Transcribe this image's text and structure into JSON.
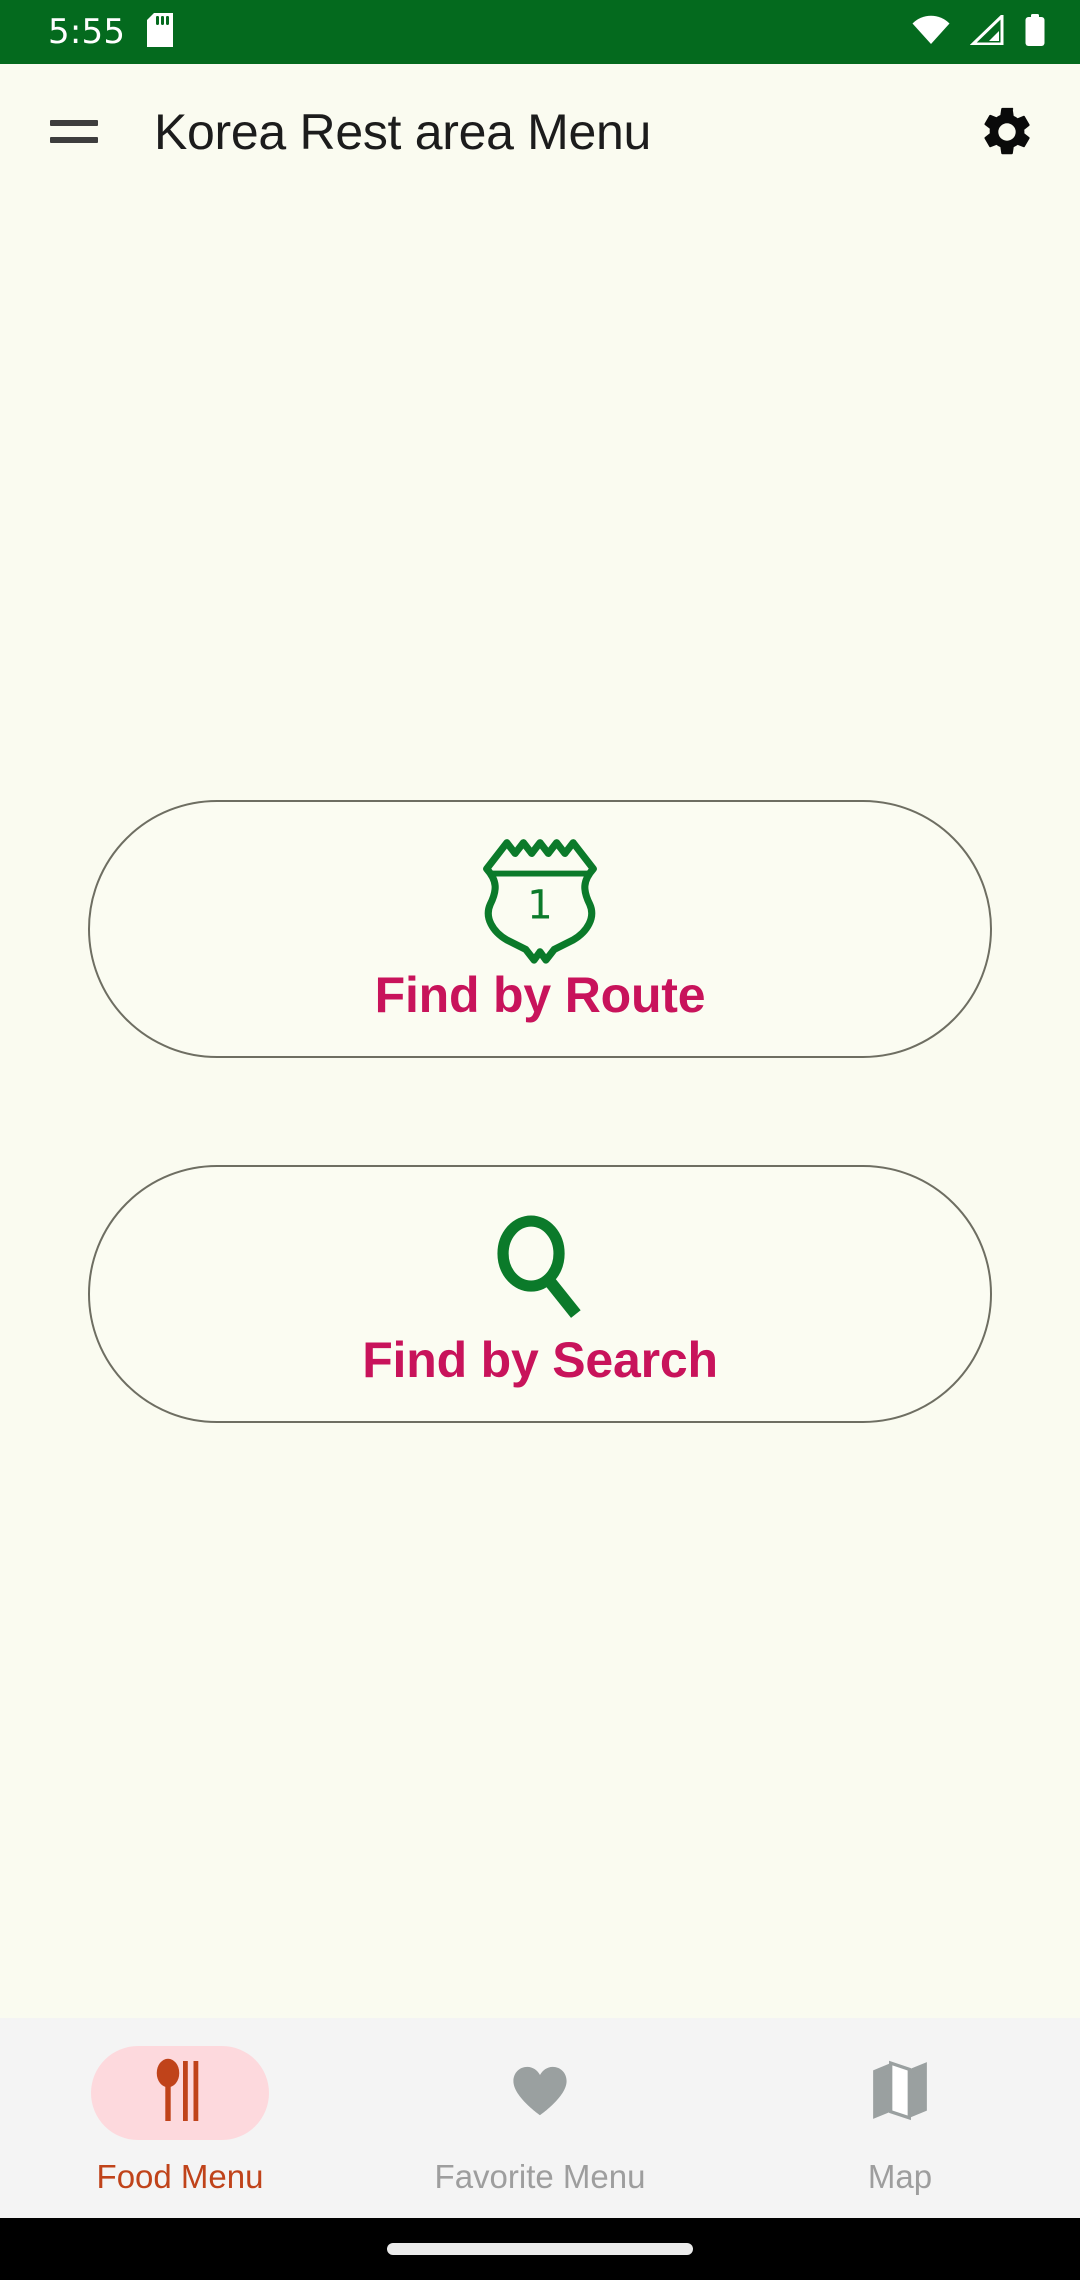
{
  "status_bar": {
    "time": "5:55",
    "background_color": "#046A1E",
    "icons": {
      "sd_card": "sd-card-icon",
      "wifi": "wifi-icon",
      "cellular": "cellular-signal-icon",
      "battery": "battery-full-icon"
    }
  },
  "app_bar": {
    "menu_icon": "hamburger-menu-icon",
    "title": "Korea Rest area Menu",
    "settings_icon": "gear-icon",
    "background_color": "#FAFBF0",
    "title_color": "#1C1C1C"
  },
  "main": {
    "buttons": [
      {
        "label": "Find by Route",
        "icon": "route-shield-icon",
        "icon_text": "1",
        "icon_color": "#0B7A2A",
        "label_color": "#C8135B",
        "border_color": "#6E6E62"
      },
      {
        "label": "Find by Search",
        "icon": "magnifying-glass-icon",
        "icon_color": "#0B7A2A",
        "label_color": "#C8135B",
        "border_color": "#6E6E62"
      }
    ]
  },
  "bottom_nav": {
    "background_color": "#F4F4F4",
    "active_color": "#C0431A",
    "active_pill_color": "#FDD9DD",
    "inactive_color": "#9E9E9E",
    "items": [
      {
        "label": "Food Menu",
        "icon": "utensils-icon",
        "active": true
      },
      {
        "label": "Favorite Menu",
        "icon": "heart-icon",
        "active": false
      },
      {
        "label": "Map",
        "icon": "map-icon",
        "active": false
      }
    ]
  },
  "system_nav": {
    "home_indicator": "home-indicator-pill",
    "background_color": "#000000"
  }
}
